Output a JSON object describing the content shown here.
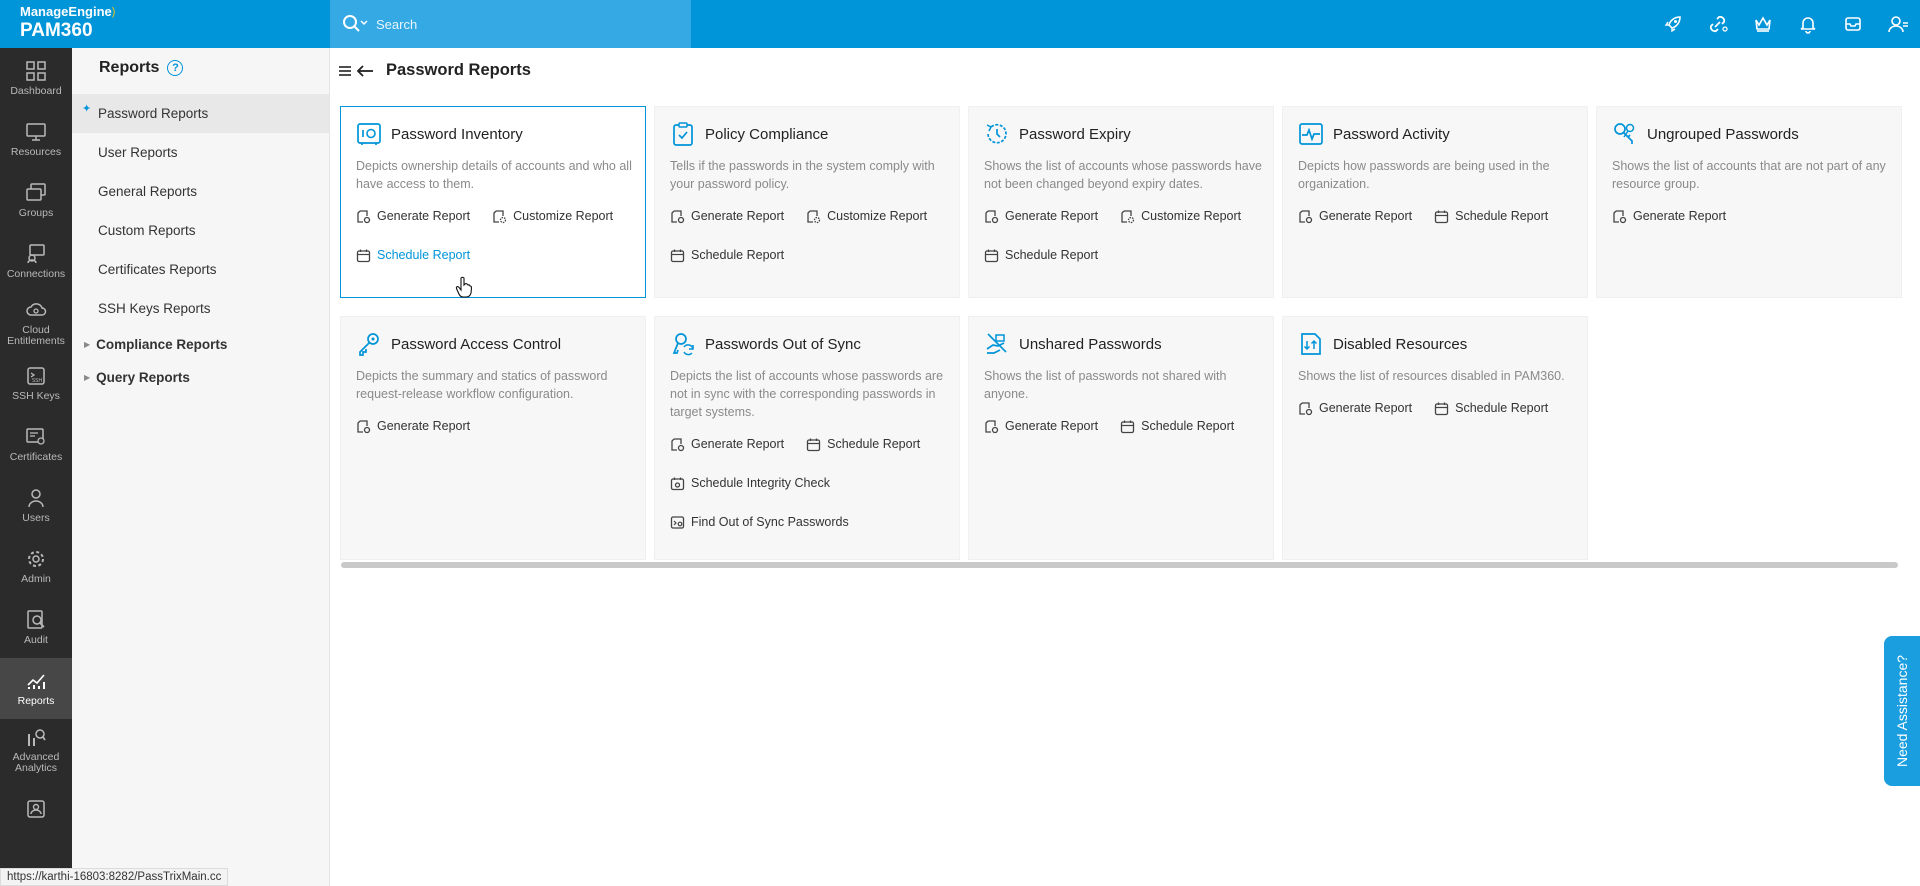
{
  "brand": {
    "company": "ManageEngine",
    "product": "PAM360"
  },
  "search": {
    "placeholder": "Search"
  },
  "top_icons": [
    "rocket-icon",
    "link-key-icon",
    "crown-icon",
    "bell-icon",
    "mail-icon",
    "user-icon"
  ],
  "left_nav": [
    {
      "label": "Dashboard",
      "icon": "dashboard-icon"
    },
    {
      "label": "Resources",
      "icon": "monitor-icon"
    },
    {
      "label": "Groups",
      "icon": "groups-icon"
    },
    {
      "label": "Connections",
      "icon": "connections-icon"
    },
    {
      "label": "Cloud Entitlements",
      "icon": "cloud-icon"
    },
    {
      "label": "SSH Keys",
      "icon": "ssh-icon"
    },
    {
      "label": "Certificates",
      "icon": "certificate-icon"
    },
    {
      "label": "Users",
      "icon": "user-icon"
    },
    {
      "label": "Admin",
      "icon": "gear-icon"
    },
    {
      "label": "Audit",
      "icon": "audit-icon"
    },
    {
      "label": "Reports",
      "icon": "reports-chart-icon",
      "active": true
    },
    {
      "label": "Advanced Analytics",
      "icon": "analytics-icon"
    },
    {
      "label": "",
      "icon": "contact-card-icon"
    }
  ],
  "subnav": {
    "title": "Reports",
    "items": [
      "Password Reports",
      "User Reports",
      "General Reports",
      "Custom Reports",
      "Certificates Reports",
      "SSH Keys Reports"
    ],
    "groups": [
      "Compliance Reports",
      "Query Reports"
    ]
  },
  "main": {
    "title": "Password Reports"
  },
  "cards": [
    {
      "title": "Password Inventory",
      "desc": "Depicts ownership details of accounts and who all have access to them.",
      "actions": [
        "Generate Report",
        "Customize Report",
        "Schedule Report"
      ]
    },
    {
      "title": "Policy Compliance",
      "desc": "Tells if the passwords in the system comply with your password policy.",
      "actions": [
        "Generate Report",
        "Customize Report",
        "Schedule Report"
      ]
    },
    {
      "title": "Password Expiry",
      "desc": "Shows the list of accounts whose passwords have not been changed beyond expiry dates.",
      "actions": [
        "Generate Report",
        "Customize Report",
        "Schedule Report"
      ]
    },
    {
      "title": "Password Activity",
      "desc": "Depicts how passwords are being used in the organization.",
      "actions": [
        "Generate Report",
        "Schedule Report"
      ]
    },
    {
      "title": "Ungrouped Passwords",
      "desc": "Shows the list of accounts that are not part of any resource group.",
      "actions": [
        "Generate Report"
      ]
    },
    {
      "title": "Password Access Control",
      "desc": "Depicts the summary and statics of password request-release workflow configuration.",
      "actions": [
        "Generate Report"
      ]
    },
    {
      "title": "Passwords Out of Sync",
      "desc": "Depicts the list of accounts whose passwords are not in sync with the corresponding passwords in target systems.",
      "actions": [
        "Generate Report",
        "Schedule Report",
        "Schedule Integrity Check",
        "Find Out of Sync Passwords"
      ]
    },
    {
      "title": "Unshared Passwords",
      "desc": "Shows the list of passwords not shared with anyone.",
      "actions": [
        "Generate Report",
        "Schedule Report"
      ]
    },
    {
      "title": "Disabled Resources",
      "desc": "Shows the list of resources disabled in PAM360.",
      "actions": [
        "Generate Report",
        "Schedule Report"
      ]
    }
  ],
  "status_url": "https://karthi-16803:8282/PassTrixMain.cc",
  "assistance": "Need Assistance?",
  "colors": {
    "topbar": "#0094d9",
    "search": "#34a9e3",
    "nav": "#2b2b2b",
    "accent": "#0094d9"
  }
}
